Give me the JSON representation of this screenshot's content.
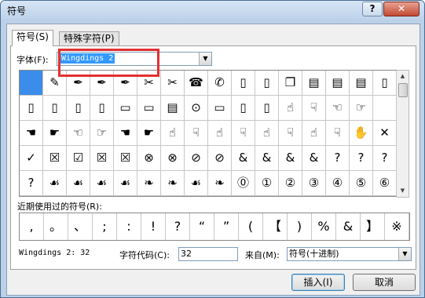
{
  "window": {
    "title": "符号",
    "help_label": "?",
    "close_label": "✕"
  },
  "tabs": [
    {
      "label": "符号(S)"
    },
    {
      "label": "特殊字符(P)"
    }
  ],
  "font": {
    "label": "字体(F):",
    "value": "Wingdings 2"
  },
  "grid": {
    "selected_index": 0,
    "rows": [
      [
        "",
        "✎",
        "✒",
        "✒",
        "✒",
        "✂",
        "✂",
        "☎",
        "✆",
        "▯",
        "▯",
        "❐",
        "▤",
        "▤",
        "▤",
        "▯"
      ],
      [
        "▯",
        "▯",
        "▯",
        "▯",
        "▭",
        "▭",
        "▤",
        "⊙",
        "▭",
        "▯",
        "▯",
        "☝",
        "☟",
        "☜",
        "☞",
        ""
      ],
      [
        "☚",
        "☛",
        "☜",
        "☞",
        "☚",
        "☛",
        "☝",
        "☟",
        "☝",
        "☟",
        "☝",
        "☟",
        "☝",
        "☟",
        "✋",
        "✕"
      ],
      [
        "✓",
        "☒",
        "☑",
        "☒",
        "☒",
        "⊗",
        "⊗",
        "⊘",
        "⊘",
        "&",
        "&",
        "&",
        "&",
        "?",
        "?",
        "?"
      ],
      [
        "?",
        "☙",
        "☙",
        "☙",
        "☙",
        "❧",
        "❧",
        "☙",
        "❧",
        "⓪",
        "①",
        "②",
        "③",
        "④",
        "⑤",
        "⑥"
      ]
    ]
  },
  "recent": {
    "label": "近期使用过的符号(R):",
    "symbols": [
      ",",
      "。",
      "、",
      ";",
      ":",
      "!",
      "?",
      "“",
      "”",
      "(",
      "【",
      ")",
      "%",
      "&",
      "】",
      "※"
    ]
  },
  "status": {
    "info": "Wingdings 2: 32",
    "code_label": "字符代码(C):",
    "code_value": "32",
    "from_label": "来自(M):",
    "from_value": "符号(十进制)"
  },
  "buttons": {
    "insert_label": "插入(I)",
    "cancel_label": "取消"
  }
}
